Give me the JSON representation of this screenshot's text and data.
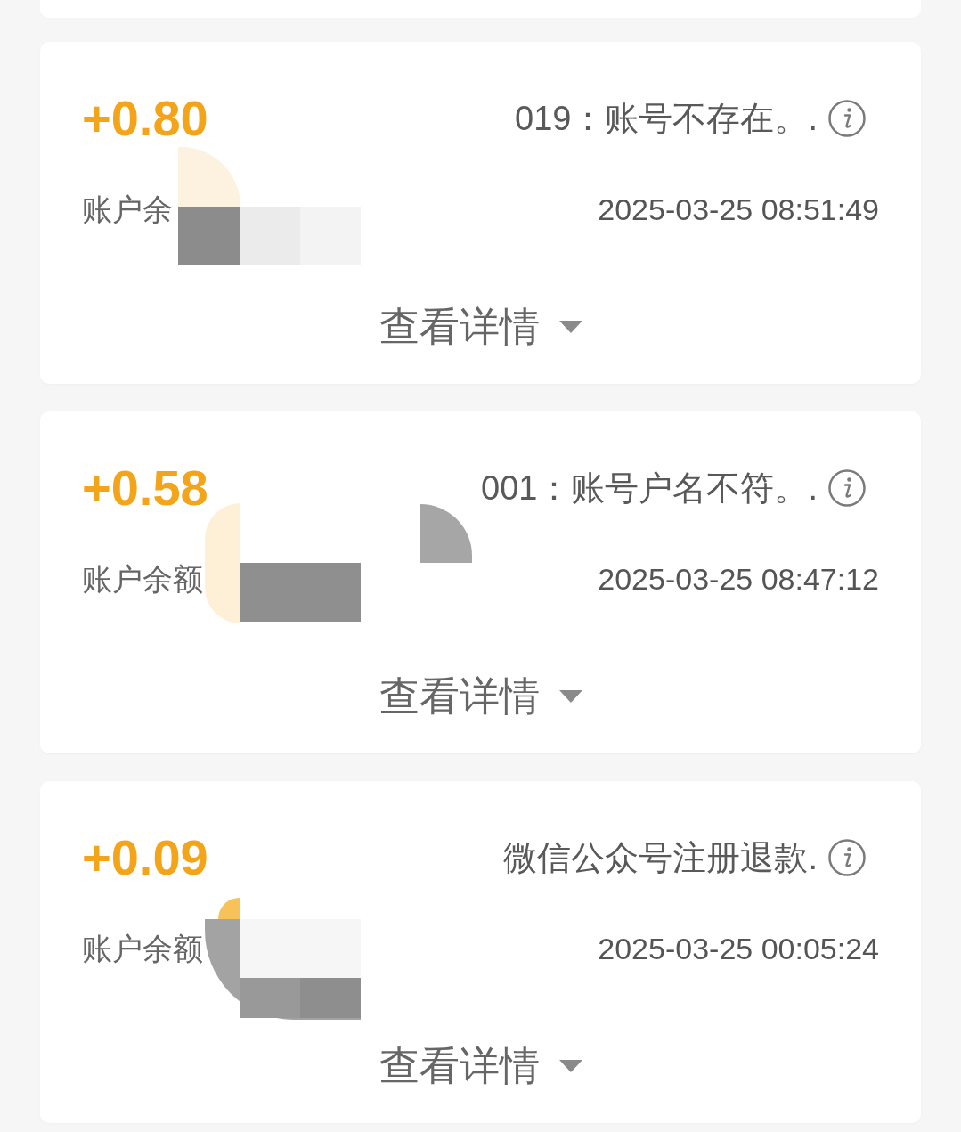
{
  "transactions": [
    {
      "amount": "+0.80",
      "description": "019：账号不存在。.",
      "balance_label": "账户余",
      "time": "2025-03-25 08:51:49",
      "details_link": "查看详情",
      "expanded": false
    },
    {
      "amount": "+0.58",
      "description": "001：账号户名不符。.",
      "balance_label": "账户余额",
      "time": "2025-03-25 08:47:12",
      "details_link": "查看详情",
      "expanded": false
    },
    {
      "amount": "+0.09",
      "description": "微信公众号注册退款.",
      "balance_label": "账户余额",
      "time": "2025-03-25 00:05:24",
      "details_link": "查看详情",
      "expanded": false
    }
  ]
}
